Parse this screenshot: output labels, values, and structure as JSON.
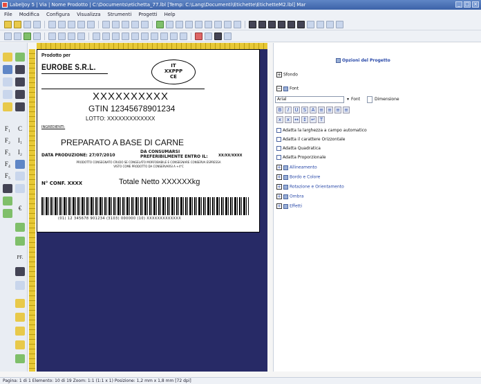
{
  "window": {
    "title": "LabelJoy 5 | Via | Nome Prodotto  | C:\\Documents\\etichetta_77.lbl  [Temp: C:\\Lang\\Documenti\\Etichette\\EtichetteM2.lbl]  Mar"
  },
  "menu": [
    "File",
    "Modifica",
    "Configura",
    "Visualizza",
    "Strumenti",
    "Progetti",
    "Help"
  ],
  "label": {
    "prodotto_per": "Prodotto per",
    "company": "EUROBE S.R.L.",
    "oval_lines": [
      "IT",
      "XXPPP",
      "CE"
    ],
    "product_code": "XXXXXXXXXX",
    "gtin": "GTIN  12345678901234",
    "lotto": "LOTTO:  XXXXXXXXXXXXX",
    "ingredienti": "INGREDIENTI:",
    "preparato": "PREPARATO A BASE DI CARNE",
    "data_produzione": "DATA PRODUZIONE:  27/07/2010",
    "consumare_lines": [
      "DA CONSUMARSI",
      "PREFERIBILMENTE ENTRO IL:"
    ],
    "entro_value": "XX/XX/XXXX",
    "prodotto_text_lines": [
      "PRODOTTO CONSEGNATO CRUDO SE CONGELATO  MORFOBABILE E CONSEGNARE CONSERVA ESPRESSA",
      "VISTO COME PRODOTTO DA CONSERVARSI A +4°C"
    ],
    "n_comp": "N° CONF. XXXX",
    "totale_netto": "Totale Netto  XXXXXXkg",
    "barcode_text": "(01) 12 345678 901234 (3103) 000000 (10) XXXXXXXXXXXXX"
  },
  "right_panel": {
    "header": "Opzioni del Progetto",
    "sfondo": "Sfondo",
    "font_section": "Font",
    "font_name": "Arial",
    "font_label": "Font",
    "dimensione": "Dimensione",
    "checkbox_items": [
      "Adatta la larghezza a campo automatico",
      "Adatta il carattere Orizzontale",
      "Adatta Quadratica",
      "Adatta Proporzionale"
    ],
    "tree_items": [
      "Allineamento",
      "Bordo e Colore",
      "Rotazione e Orientamento",
      "Ombra",
      "Effetti"
    ]
  },
  "status": {
    "text": "Pagina: 1 di 1    Elemento: 10 di 19    Zoom: 1:1 (1:1 x 1)    Posizione: 1,2 mm x 1,8 mm  [72 dpi]"
  },
  "palette_glyphs": [
    "F₁",
    "C",
    "F₂",
    "I₁",
    "F₃",
    "I₂",
    "F₄",
    "F₅",
    "PF.",
    "€"
  ]
}
